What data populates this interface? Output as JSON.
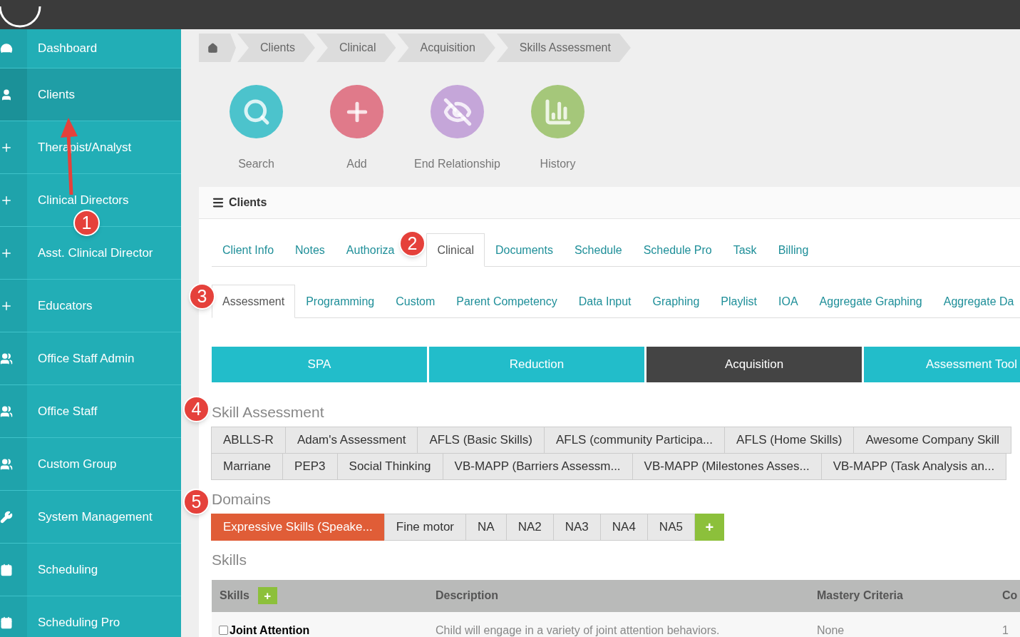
{
  "sidebar": {
    "items": [
      {
        "label": "Dashboard",
        "selected": false
      },
      {
        "label": "Clients",
        "selected": true
      },
      {
        "label": "Therapist/Analyst",
        "selected": false
      },
      {
        "label": "Clinical Directors",
        "selected": false
      },
      {
        "label": "Asst. Clinical Director",
        "selected": false
      },
      {
        "label": "Educators",
        "selected": false
      },
      {
        "label": "Office Staff Admin",
        "selected": false
      },
      {
        "label": "Office Staff",
        "selected": false
      },
      {
        "label": "Custom Group",
        "selected": false
      },
      {
        "label": "System Management",
        "selected": false
      },
      {
        "label": "Scheduling",
        "selected": false
      },
      {
        "label": "Scheduling Pro",
        "selected": false
      }
    ]
  },
  "breadcrumb": [
    "Clients",
    "Clinical",
    "Acquisition",
    "Skills Assessment"
  ],
  "actions": [
    "Search",
    "Add",
    "End Relationship",
    "History"
  ],
  "panel": {
    "title": "Clients",
    "tabs": [
      {
        "label": "Client Info",
        "selected": false
      },
      {
        "label": "Notes",
        "selected": false
      },
      {
        "label": "Authoriza",
        "selected": false
      },
      {
        "label": "Clinical",
        "selected": true
      },
      {
        "label": "Documents",
        "selected": false
      },
      {
        "label": "Schedule",
        "selected": false
      },
      {
        "label": "Schedule Pro",
        "selected": false
      },
      {
        "label": "Task",
        "selected": false
      },
      {
        "label": "Billing",
        "selected": false
      }
    ],
    "subtabs": [
      {
        "label": "Assessment",
        "selected": true
      },
      {
        "label": "Programming",
        "selected": false
      },
      {
        "label": "Custom",
        "selected": false
      },
      {
        "label": "Parent Competency",
        "selected": false
      },
      {
        "label": "Data Input",
        "selected": false
      },
      {
        "label": "Graphing",
        "selected": false
      },
      {
        "label": "Playlist",
        "selected": false
      },
      {
        "label": "IOA",
        "selected": false
      },
      {
        "label": "Aggregate Graphing",
        "selected": false
      },
      {
        "label": "Aggregate Da",
        "selected": false
      }
    ],
    "categories": [
      {
        "label": "SPA",
        "selected": false
      },
      {
        "label": "Reduction",
        "selected": false
      },
      {
        "label": "Acquisition",
        "selected": true
      },
      {
        "label": "Assessment Tool",
        "selected": false
      }
    ],
    "skill_assessment": {
      "title": "Skill Assessment",
      "lines": [
        {
          "buttons": [
            "ABLLS-R",
            "Adam's Assessment",
            "AFLS (Basic Skills)",
            "AFLS (community Participa...",
            "AFLS (Home Skills)",
            "Awesome Company Skill"
          ]
        },
        {
          "buttons": [
            "Marriane",
            "PEP3",
            "Social Thinking",
            "VB-MAPP (Barriers Assessm...",
            "VB-MAPP (Milestones Asses...",
            "VB-MAPP (Task Analysis an..."
          ]
        }
      ]
    },
    "domains": {
      "title": "Domains",
      "items": [
        {
          "label": "Expressive Skills (Speake...",
          "selected": true
        },
        {
          "label": "Fine motor",
          "selected": false
        },
        {
          "label": "NA",
          "selected": false
        },
        {
          "label": "NA2",
          "selected": false
        },
        {
          "label": "NA3",
          "selected": false
        },
        {
          "label": "NA4",
          "selected": false
        },
        {
          "label": "NA5",
          "selected": false
        }
      ],
      "add": "+"
    },
    "skills": {
      "title": "Skills",
      "add": "+",
      "columns": [
        "Skills",
        "Description",
        "Mastery Criteria",
        "Co"
      ],
      "rows": [
        {
          "checked": false,
          "cells": [
            "Joint Attention",
            "Child will engage in a variety of joint attention behaviors.",
            "None",
            "1"
          ]
        }
      ]
    }
  },
  "annotations": [
    "1",
    "2",
    "3",
    "4",
    "5"
  ]
}
